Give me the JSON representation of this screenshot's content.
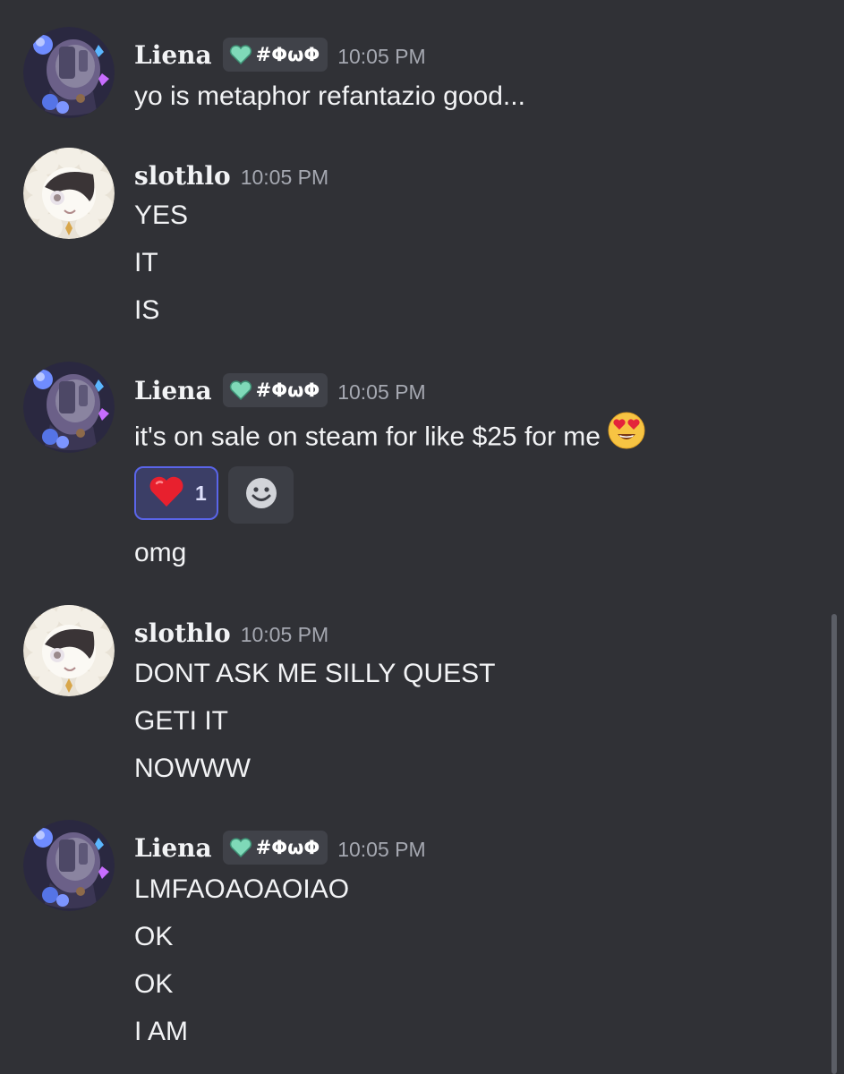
{
  "colors": {
    "background": "#303136",
    "tag_background": "#404249",
    "timestamp": "#a5a8b1",
    "reaction_border": "#5a65ea",
    "reaction_background": "#3b3e66"
  },
  "messages": [
    {
      "author": "Liena",
      "tag_icon": "green-heart-icon",
      "tag": "#ΦωΦ",
      "time": "10:05 PM",
      "lines": [
        "yo is metaphor refantazio good..."
      ]
    },
    {
      "author": "slothlo",
      "time": "10:05 PM",
      "lines": [
        "YES",
        "IT",
        "IS"
      ]
    },
    {
      "author": "Liena",
      "tag_icon": "green-heart-icon",
      "tag": "#ΦωΦ",
      "time": "10:05 PM",
      "lines": [
        "it's on sale on steam for like $25 for me"
      ],
      "inline_emoji": "heart-eyes-emoji",
      "reaction": {
        "emoji": "red-heart-emoji",
        "count": "1",
        "reacted_by_me": true
      },
      "add_reaction_icon": "smiley-icon",
      "after_reaction_lines": [
        "omg"
      ]
    },
    {
      "author": "slothlo",
      "time": "10:05 PM",
      "lines": [
        "DONT ASK ME SILLY QUEST",
        "GETI IT",
        "NOWWW"
      ]
    },
    {
      "author": "Liena",
      "tag_icon": "green-heart-icon",
      "tag": "#ΦωΦ",
      "time": "10:05 PM",
      "lines": [
        "LMFAOAOAOIAO",
        "OK",
        "OK",
        "I AM"
      ]
    }
  ]
}
